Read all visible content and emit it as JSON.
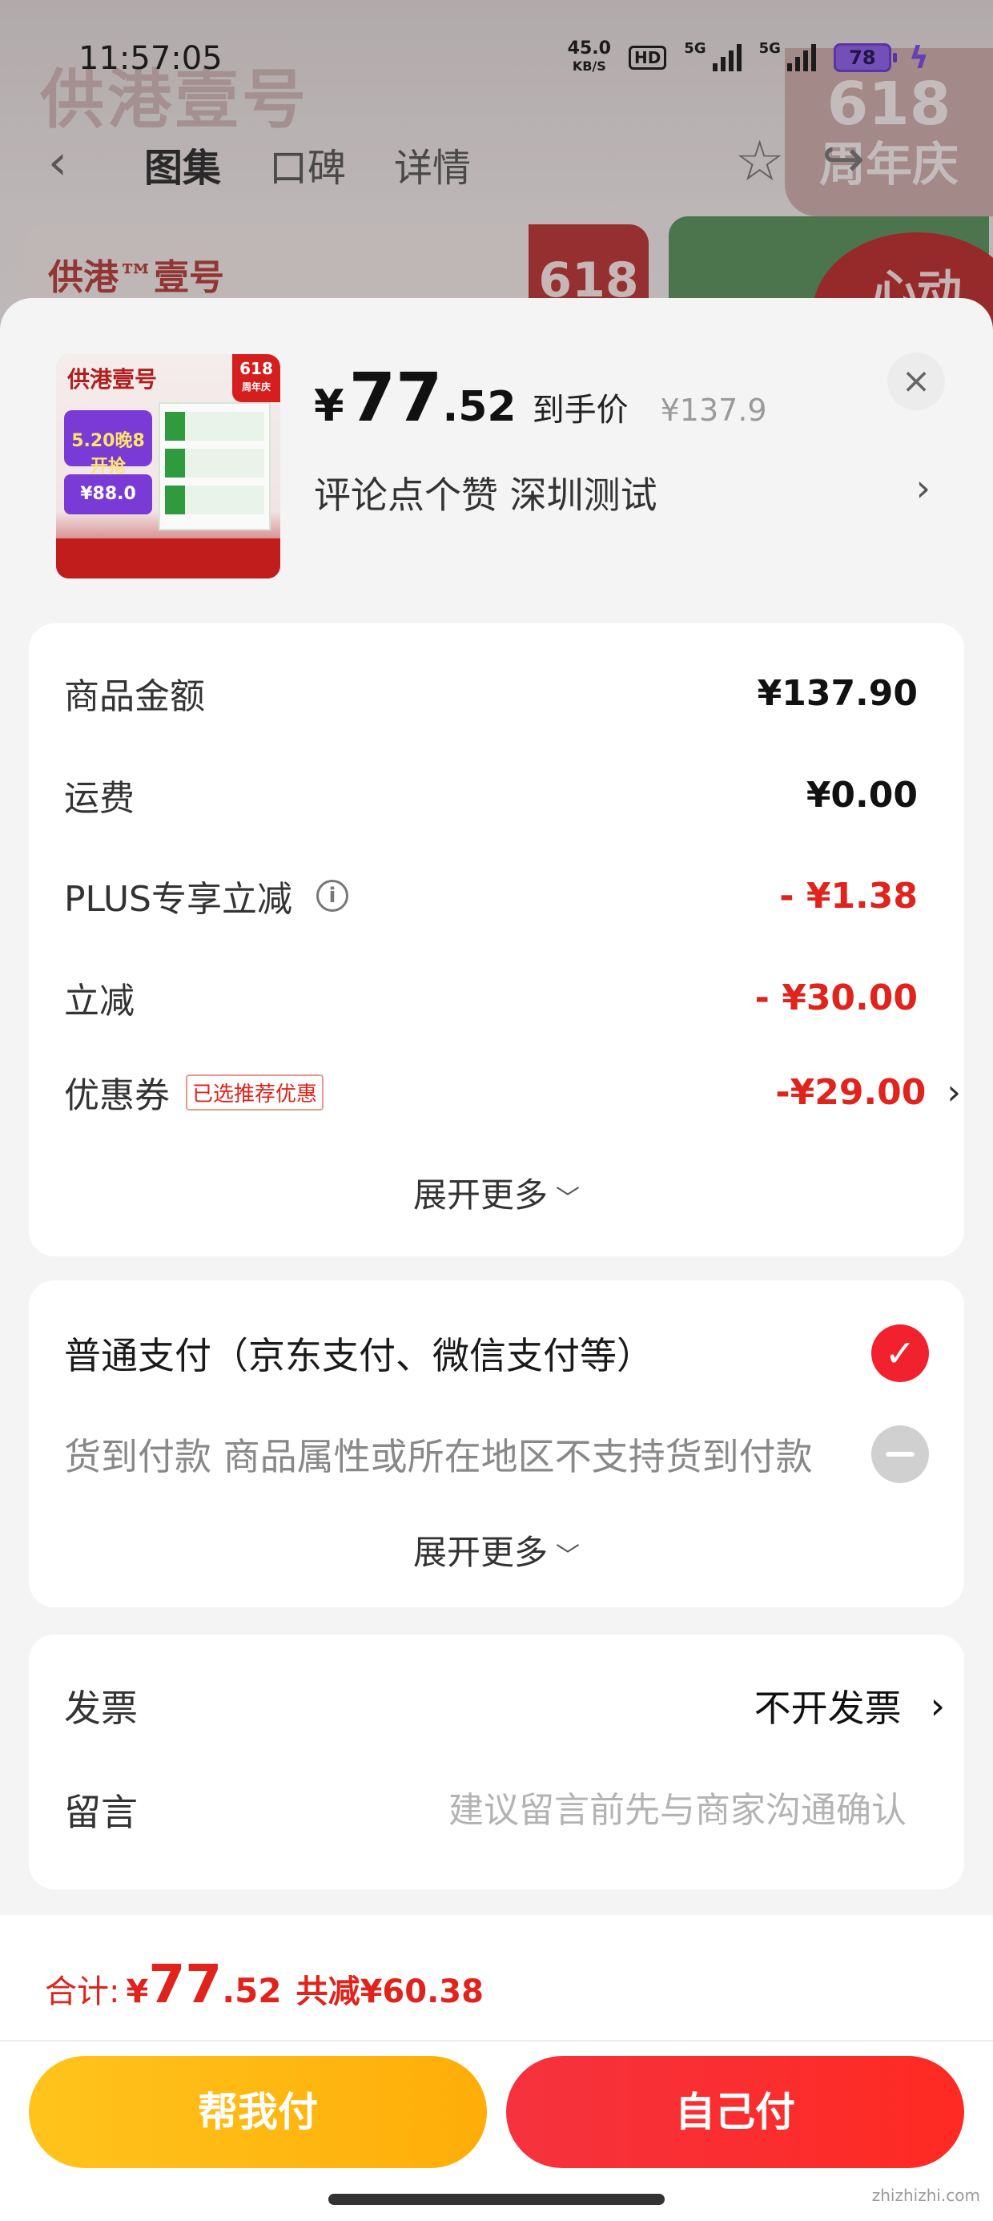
{
  "status_bar": {
    "time": "11:57:05",
    "net_speed": "45.0",
    "net_unit": "KB/S",
    "hd": "HD",
    "sig1": "5G",
    "sig2": "5G",
    "battery": "78"
  },
  "nav": {
    "tabs": [
      "图集",
      "口碑",
      "详情"
    ]
  },
  "background": {
    "brand": "供港壹号",
    "brand_small": "供港™壹号",
    "tag_num": "618",
    "tag_text": "周年庆",
    "tag_right": "心动"
  },
  "product": {
    "image_brand": "供港壹号",
    "image_618": "618",
    "image_anniv": "周年庆",
    "image_promo": "5.20晚8开抢",
    "image_price": "¥88.0",
    "price_currency": "¥",
    "price_int": "77",
    "price_dec": ".52",
    "price_note": "到手价",
    "original_price": "¥137.9",
    "spec": "评论点个赞  深圳测试",
    "spec_arrow": "›",
    "close": "×"
  },
  "price_breakdown": {
    "goods_amount": {
      "label": "商品金额",
      "value": "¥137.90"
    },
    "shipping": {
      "label": "运费",
      "value": "¥0.00"
    },
    "plus": {
      "label": "PLUS专享立减",
      "value": "- ¥1.38"
    },
    "instant": {
      "label": "立减",
      "value": "- ¥30.00"
    },
    "coupon": {
      "label": "优惠券",
      "tag": "已选推荐优惠",
      "value": "-¥29.00",
      "arrow": "›"
    },
    "expand": "展开更多"
  },
  "payment": {
    "normal": "普通支付（京东支付、微信支付等）",
    "cod": "货到付款 商品属性或所在地区不支持货到付款",
    "expand": "展开更多",
    "check": "✓"
  },
  "invoice": {
    "label": "发票",
    "value": "不开发票",
    "arrow": "›"
  },
  "message": {
    "label": "留言",
    "placeholder": "建议留言前先与商家沟通确认"
  },
  "total": {
    "label": "合计:",
    "currency": "¥",
    "int": "77",
    "dec": ".52",
    "saved": "共减¥60.38"
  },
  "buttons": {
    "help_pay": "帮我付",
    "self_pay": "自己付"
  },
  "watermark": "zhizhizhi.com",
  "colors": {
    "accent_red": "#e0231c",
    "help_yellow": "#ffb40f",
    "self_red": "#f5303a"
  }
}
